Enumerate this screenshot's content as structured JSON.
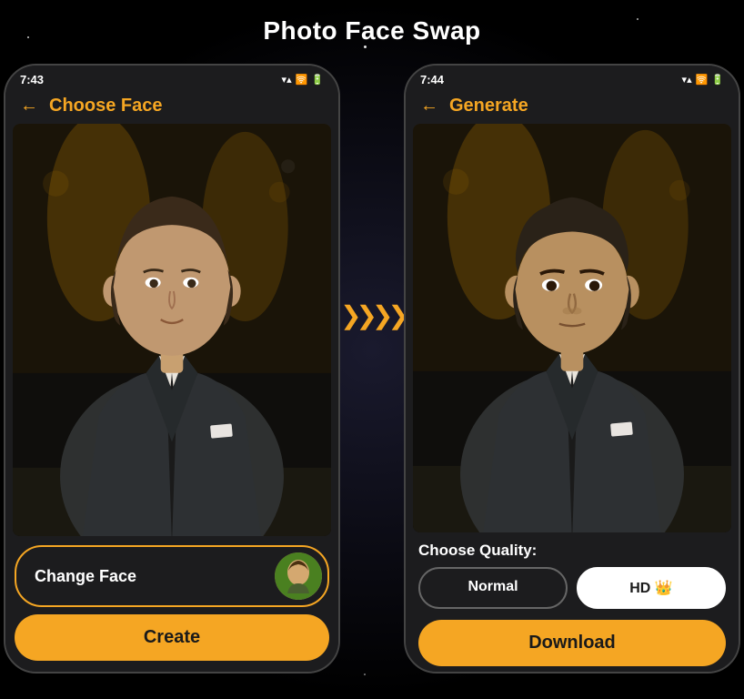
{
  "page": {
    "title": "Photo Face Swap",
    "background": "#000"
  },
  "left_phone": {
    "status_time": "7:43",
    "nav_title": "Choose Face",
    "nav_title_color": "yellow",
    "change_face_label": "Change Face",
    "create_button_label": "Create"
  },
  "right_phone": {
    "status_time": "7:44",
    "nav_title": "Generate",
    "nav_title_color": "yellow",
    "quality_label": "Choose Quality:",
    "quality_normal": "Normal",
    "quality_hd": "HD 👑",
    "download_button_label": "Download"
  },
  "arrows": "❯❯❯❯",
  "icons": {
    "back_arrow": "←",
    "signal": "▲",
    "wifi": "▲",
    "battery": "▮"
  }
}
